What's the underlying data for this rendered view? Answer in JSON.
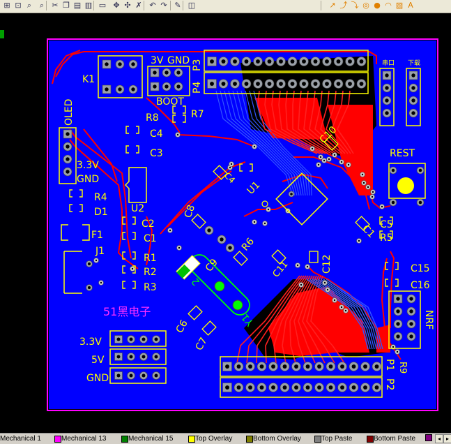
{
  "colors": {
    "board_fill": "#0000ff",
    "top_copper": "#ff0000",
    "overlay": "#ffff00",
    "outline": "#ff00ff",
    "pad": "#9aa0a8",
    "text_magenta": "#ff30ff"
  },
  "toolbar": {
    "icons": [
      "zoom-fit-icon",
      "zoom-area-icon",
      "zoom-icon",
      "zoom-out-icon",
      "cut-icon",
      "copy-icon",
      "paste-icon",
      "clipboard-icon",
      "select-rect-icon",
      "move-icon",
      "cross-select-icon",
      "deselect-icon",
      "undo-icon",
      "redo-icon",
      "highlight-icon",
      "browse-icon",
      "route-icon",
      "route2-icon",
      "route3-icon",
      "pad-icon",
      "via-icon",
      "arc-icon",
      "fill-icon",
      "text-icon"
    ]
  },
  "layer_tabs": [
    {
      "label": "Mechanical 1",
      "color": "#ff00ff"
    },
    {
      "label": "Mechanical 13",
      "color": "#ff00ff"
    },
    {
      "label": "Mechanical 15",
      "color": "#008000"
    },
    {
      "label": "Top Overlay",
      "color": "#ffff00"
    },
    {
      "label": "Bottom Overlay",
      "color": "#808000"
    },
    {
      "label": "Top Paste",
      "color": "#808080"
    },
    {
      "label": "Bottom Paste",
      "color": "#800000"
    }
  ],
  "board": {
    "designators": {
      "K1": "K1",
      "v3v": "3V",
      "gnd_top": "GND",
      "P3": "P3",
      "P4": "P4",
      "BOOT": "BOOT",
      "R8": "R8",
      "R7": "R7",
      "C4": "C4",
      "C3": "C3",
      "OLED": "OLED",
      "v33": "3.3V",
      "gnd_left": "GND",
      "R4": "R4",
      "D1": "D1",
      "U2": "U2",
      "F1": "F1",
      "C2": "C2",
      "C1": "C1",
      "J1": "J1",
      "R1": "R1",
      "R2": "R2",
      "R3": "R3",
      "brand": "51黑电子",
      "C8": "C8",
      "C9": "C9",
      "R6": "R6",
      "U1": "U1",
      "C4b": "C4",
      "C10": "C10",
      "RESET": "REST",
      "C1b": "C1",
      "C5": "C5",
      "R5": "R5",
      "C11": "C11",
      "C12": "C12",
      "C15": "C15",
      "C16": "C16",
      "C6": "C6",
      "C7": "C7",
      "Y1": "Y1",
      "NRF": "NRF",
      "R9": "R9",
      "P1": "P1",
      "P2": "P2",
      "pwr33": "3.3V",
      "pwr5": "5V",
      "pwrgnd": "GND",
      "xtal": "2",
      "dl_left": "串口",
      "dl_right": "下载"
    }
  }
}
